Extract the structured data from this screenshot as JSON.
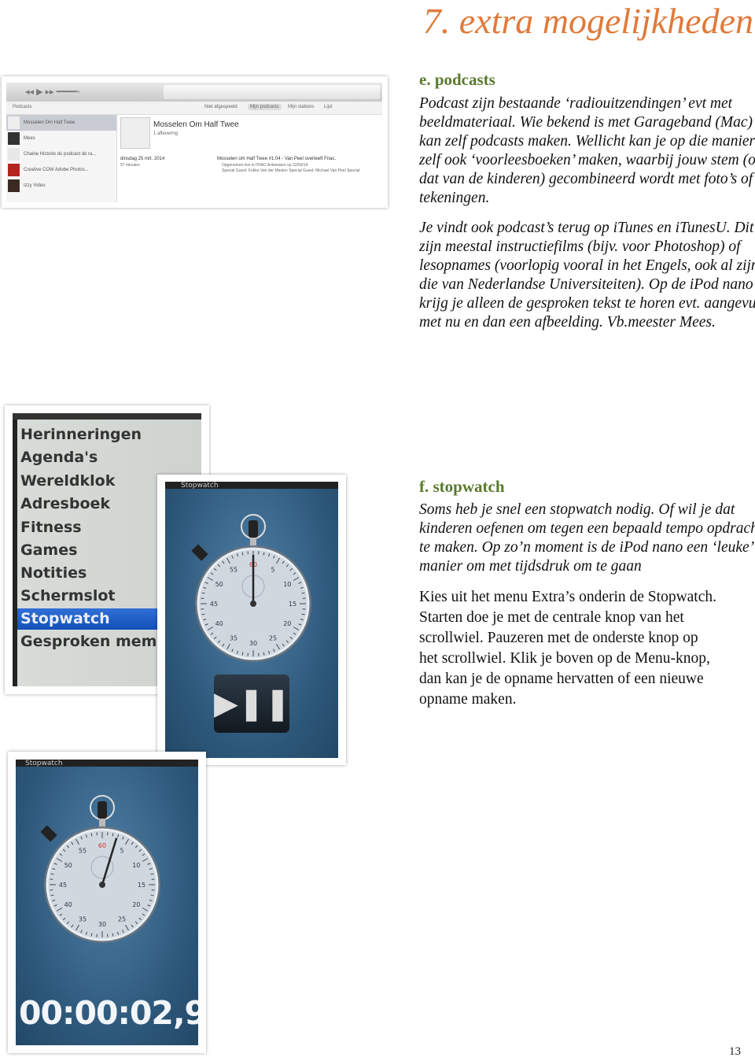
{
  "chapter_title": "7. extra mogelijkheden",
  "podcasts": {
    "heading": "e. podcasts",
    "para1_lines": [
      "Podcast zijn bestaande ‘radiouitzendingen’ evt met",
      "beeldmateriaal.  Wie bekend is met Garageband (Mac)",
      "kan zelf podcasts maken. Wellicht kan je op die manier",
      "zelf ook ‘voorleesboeken’ maken, waarbij jouw stem (of",
      "dat van de kinderen) gecombineerd wordt met foto’s of",
      "tekeningen."
    ],
    "para2_lines": [
      "Je vindt ook podcast’s terug op iTunes en iTunesU.  Dit",
      "zijn meestal instructiefilms (bijv. voor Photoshop) of",
      "lesopnames (voorlopig vooral in het Engels, ook al zijn",
      "die van Nederlandse Universiteiten).  Op de iPod nano",
      "krijg je alleen de gesproken tekst te horen evt. aangevuld",
      "met nu en dan een afbeelding.  Vb.meester Mees."
    ]
  },
  "itunes_screenshot": {
    "toolbar_left": "Podcasts",
    "tabs": [
      "Niet afgespeeld",
      "Mijn podcasts",
      "Mijn stations",
      "Lijst"
    ],
    "sidebar_items": [
      "Mosselen Om Half Twee",
      "Mees",
      "Chaine Histoire du podcast de ra...",
      "Creative COW Adobe Photos...",
      "Izzy Video"
    ],
    "podcast_title": "Mosselen Om Half Twee",
    "episode_count": "1 aflevering",
    "episode_date": "dinsdag 25 mrt. 2014",
    "episode_duration": "57 minuten",
    "episode_title": "Mosselen om Half Twee #1.04 - Van Peel overleeft Fnac.",
    "episode_desc1": "Opgenomen live in FNAC Antwerpen op 22/03/14",
    "episode_desc2": "Special Guest: Fokke Van der Meulen Special Guest: Michael Van Peel Special"
  },
  "stopwatch": {
    "heading": "f. stopwatch",
    "para1_lines": [
      "Soms heb je snel een stopwatch nodig.  Of wil je dat",
      "kinderen oefenen om tegen een bepaald tempo opdrachten",
      "te maken.  Op zo’n moment is de iPod nano een ‘leuke’",
      "manier om met tijdsdruk om te gaan"
    ],
    "para2_lines": [
      "Kies uit het menu Extra’s onderin de Stopwatch.",
      "Starten doe je met de centrale knop van het",
      "scrollwiel.  Pauzeren met de onderste knop op",
      "het scrollwiel. Klik je boven op de Menu-knop,",
      "dan kan je de opname hervatten of een nieuwe",
      "opname maken."
    ]
  },
  "ipod_menu": {
    "items": [
      "Herinneringen",
      "Agenda's",
      "Wereldklok",
      "Adresboek",
      "Fitness",
      "Games",
      "Notities",
      "Schermslot",
      "Stopwatch",
      "Gesproken memo's"
    ],
    "selected": "Stopwatch"
  },
  "ipod_stopwatch": {
    "header": "Stopwatch",
    "dial_numbers": [
      "60",
      "5",
      "10",
      "15",
      "20",
      "25",
      "30",
      "35",
      "40",
      "45",
      "50",
      "55"
    ],
    "play_pause_icon": "play-pause-icon",
    "elapsed_time": "00:00:02,9"
  },
  "page_number": "13",
  "colors": {
    "title": "#e07a3a",
    "heading": "#5a7a2e",
    "menu_highlight": "#1f5fc8"
  }
}
